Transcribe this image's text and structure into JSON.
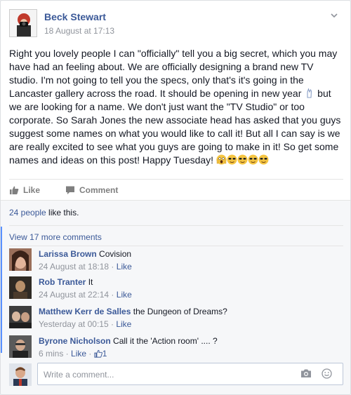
{
  "post": {
    "author": "Beck Stewart",
    "timestamp": "18 August at 17:13",
    "text": "Right you lovely people I can \"officially\" tell you a big secret, which you may have had an feeling about. We are officially designing a brand new TV studio. I'm not going to tell you the specs, only that's it's going in the Lancaster gallery across the road. It should be opening in new year",
    "text2": "but we are looking for a name. We don't just want the \"TV Studio\" or too corporate. So Sarah Jones the new associate head has asked that you guys suggest some names on what you would like to call it! But all I can say is we are really excited to see what you guys are going to make in it! So get some names and ideas on this post! Happy Tuesday!"
  },
  "actions": {
    "like": "Like",
    "comment": "Comment"
  },
  "likes": {
    "people": "24 people",
    "suffix": " like this."
  },
  "more_comments": "View 17 more comments",
  "comments": [
    {
      "name": "Larissa Brown",
      "text": "Covision",
      "time": "24 August at 18:18",
      "like": "Like"
    },
    {
      "name": "Rob Tranter",
      "text": "It",
      "time": "24 August at 22:14",
      "like": "Like"
    },
    {
      "name": "Matthew Kerr de Salles",
      "text": "the Dungeon of Dreams?",
      "time": "Yesterday at 00:15",
      "like": "Like"
    },
    {
      "name": "Byrone Nicholson",
      "text": "Call it the 'Action room' .... ?",
      "time": "6 mins",
      "like": "Like",
      "likes_count": "1"
    }
  ],
  "compose": {
    "placeholder": "Write a comment..."
  },
  "colors": {
    "link": "#3b5998",
    "meta": "#90949c",
    "background": "#f6f7f9"
  }
}
